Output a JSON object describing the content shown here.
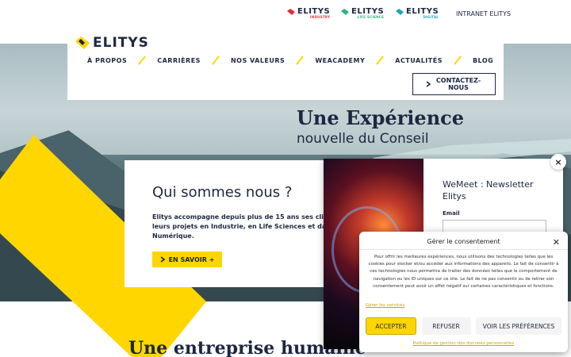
{
  "colors": {
    "navy": "#1d2741",
    "yellow": "#ffd600",
    "industry_red": "#e52e2e",
    "lifescience_green": "#2fb37a",
    "digital_teal": "#1fa5b8"
  },
  "topbar": {
    "brands": [
      {
        "name": "ELITYS",
        "sub": "INDUSTRY",
        "icon": "elitys-industry-mark-icon",
        "color": "#e52e2e"
      },
      {
        "name": "ELITYS",
        "sub": "LIFE SCIENCE",
        "icon": "elitys-lifescience-mark-icon",
        "color": "#2fb37a"
      },
      {
        "name": "ELITYS",
        "sub": "DIGITAL",
        "icon": "elitys-digital-mark-icon",
        "color": "#1fa5b8"
      }
    ],
    "intranet_label": "INTRANET ELITYS"
  },
  "header": {
    "logo_text": "ELITYS",
    "logo_icon": "elitys-logo-mark-icon",
    "nav": [
      "À PROPOS",
      "CARRIÈRES",
      "NOS VALEURS",
      "WEACADEMY",
      "ACTUALITÉS",
      "BLOG"
    ],
    "cta_label": "CONTACTEZ-NOUS"
  },
  "hero": {
    "title_line1": "Une Expérience",
    "title_line2": "nouvelle du Conseil"
  },
  "about": {
    "title": "Qui sommes nous ?",
    "text_lines": [
      "Elitys accompagne depuis plus de 15 ans ses clients dans",
      "leurs projets en Industrie, en Life Sciences et dans le",
      "Numérique."
    ],
    "button_label": "EN SAVOIR +"
  },
  "section": {
    "title": "Une entreprise humaine"
  },
  "newsletter_popup": {
    "title": "WeMeet : Newsletter Elitys",
    "email_label": "Email",
    "close_glyph": "×"
  },
  "consent": {
    "title": "Gérer le consentement",
    "close_glyph": "✕",
    "text": "Pour offrir les meilleures expériences, nous utilisons des technologies telles que les cookies pour stocker et/ou accéder aux informations des appareils. Le fait de consentir à ces technologies nous permettra de traiter des données telles que le comportement de navigation ou les ID uniques sur ce site. Le fait de ne pas consentir ou de retirer son consentement peut avoir un effet négatif sur certaines caractéristiques et fonctions.",
    "manage_link": "Gérer les services",
    "accept_label": "ACCEPTER",
    "refuse_label": "REFUSER",
    "prefs_label": "VOIR LES PRÉFÉRENCES",
    "policy_link": "Politique de gestion des données personnelles"
  }
}
